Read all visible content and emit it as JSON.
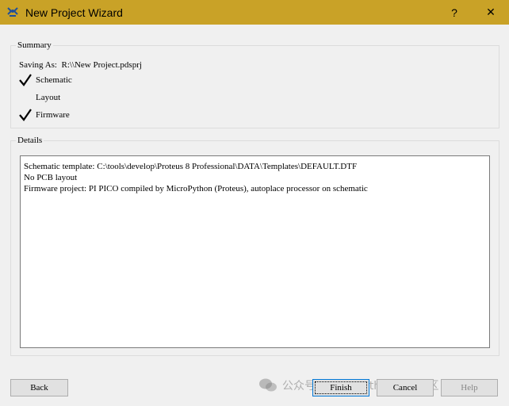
{
  "window": {
    "title": "New Project Wizard",
    "help_glyph": "?",
    "close_glyph": "✕"
  },
  "summary": {
    "group_title": "Summary",
    "saving_as": "Saving As:  R:\\\\New Project.pdsprj",
    "items": [
      {
        "label": "Schematic",
        "checked": true
      },
      {
        "label": "Layout",
        "checked": false
      },
      {
        "label": "Firmware",
        "checked": true
      }
    ]
  },
  "details": {
    "group_title": "Details",
    "lines": [
      "Schematic template: C:\\tools\\develop\\Proteus 8 Professional\\DATA\\Templates\\DEFAULT.DTF",
      "No PCB layout",
      "Firmware project: PI PICO compiled by MicroPython (Proteus), autoplace processor on schematic"
    ]
  },
  "buttons": {
    "back": "Back",
    "finish": "Finish",
    "cancel": "Cancel",
    "help": "Help"
  },
  "watermark": {
    "text": "公众号 · MicroPython中文社区",
    "icon": "wechat-icon"
  },
  "colors": {
    "titlebar": "#c9a227",
    "window_bg": "#f0f0f0",
    "focus_border": "#0078d7"
  }
}
